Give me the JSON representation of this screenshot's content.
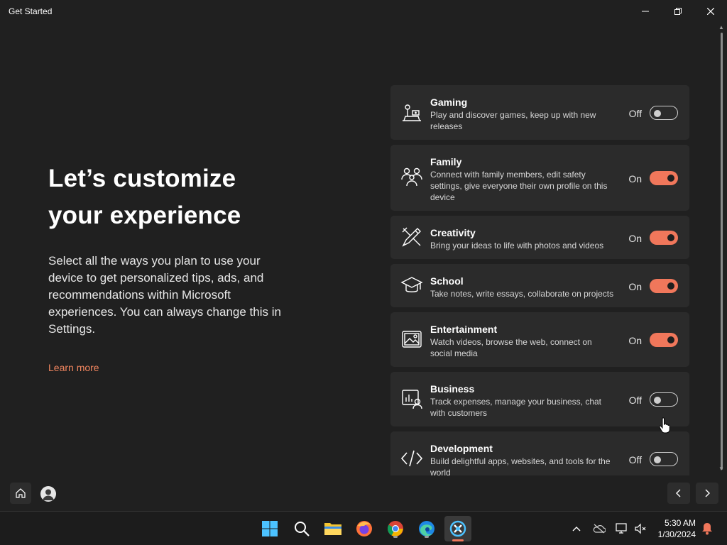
{
  "window": {
    "title": "Get Started"
  },
  "intro": {
    "headline_line1": "Let’s customize",
    "headline_line2": "your experience",
    "description": "Select all the ways you plan to use your device to get personalized tips, ads, and recommendations within Microsoft experiences. You can always change this in Settings.",
    "learn_more": "Learn more"
  },
  "colors": {
    "accent": "#f0775b",
    "link": "#f0855f",
    "card": "#2b2b2b",
    "background": "#202020"
  },
  "options": [
    {
      "id": "gaming",
      "title": "Gaming",
      "subtitle": "Play and discover games, keep up with new releases",
      "state": "Off",
      "enabled": false,
      "icon": "gaming-icon"
    },
    {
      "id": "family",
      "title": "Family",
      "subtitle": "Connect with family members, edit safety settings, give everyone their own profile on this device",
      "state": "On",
      "enabled": true,
      "icon": "family-icon"
    },
    {
      "id": "creativity",
      "title": "Creativity",
      "subtitle": "Bring your ideas to life with photos and videos",
      "state": "On",
      "enabled": true,
      "icon": "creativity-icon"
    },
    {
      "id": "school",
      "title": "School",
      "subtitle": "Take notes, write essays, collaborate on projects",
      "state": "On",
      "enabled": true,
      "icon": "graduation-cap-icon"
    },
    {
      "id": "entertainment",
      "title": "Entertainment",
      "subtitle": "Watch videos, browse the web, connect on social media",
      "state": "On",
      "enabled": true,
      "icon": "picture-icon"
    },
    {
      "id": "business",
      "title": "Business",
      "subtitle": "Track expenses, manage your business, chat with customers",
      "state": "Off",
      "enabled": false,
      "icon": "business-icon"
    },
    {
      "id": "development",
      "title": "Development",
      "subtitle": "Build delightful apps, websites, and tools for the world",
      "state": "Off",
      "enabled": false,
      "icon": "code-icon"
    }
  ],
  "taskbar": {
    "apps": [
      "windows-start-icon",
      "search-icon",
      "file-explorer-icon",
      "firefox-icon",
      "chrome-icon",
      "edge-icon",
      "get-started-app-icon"
    ],
    "time": "5:30 AM",
    "date": "1/30/2024"
  }
}
